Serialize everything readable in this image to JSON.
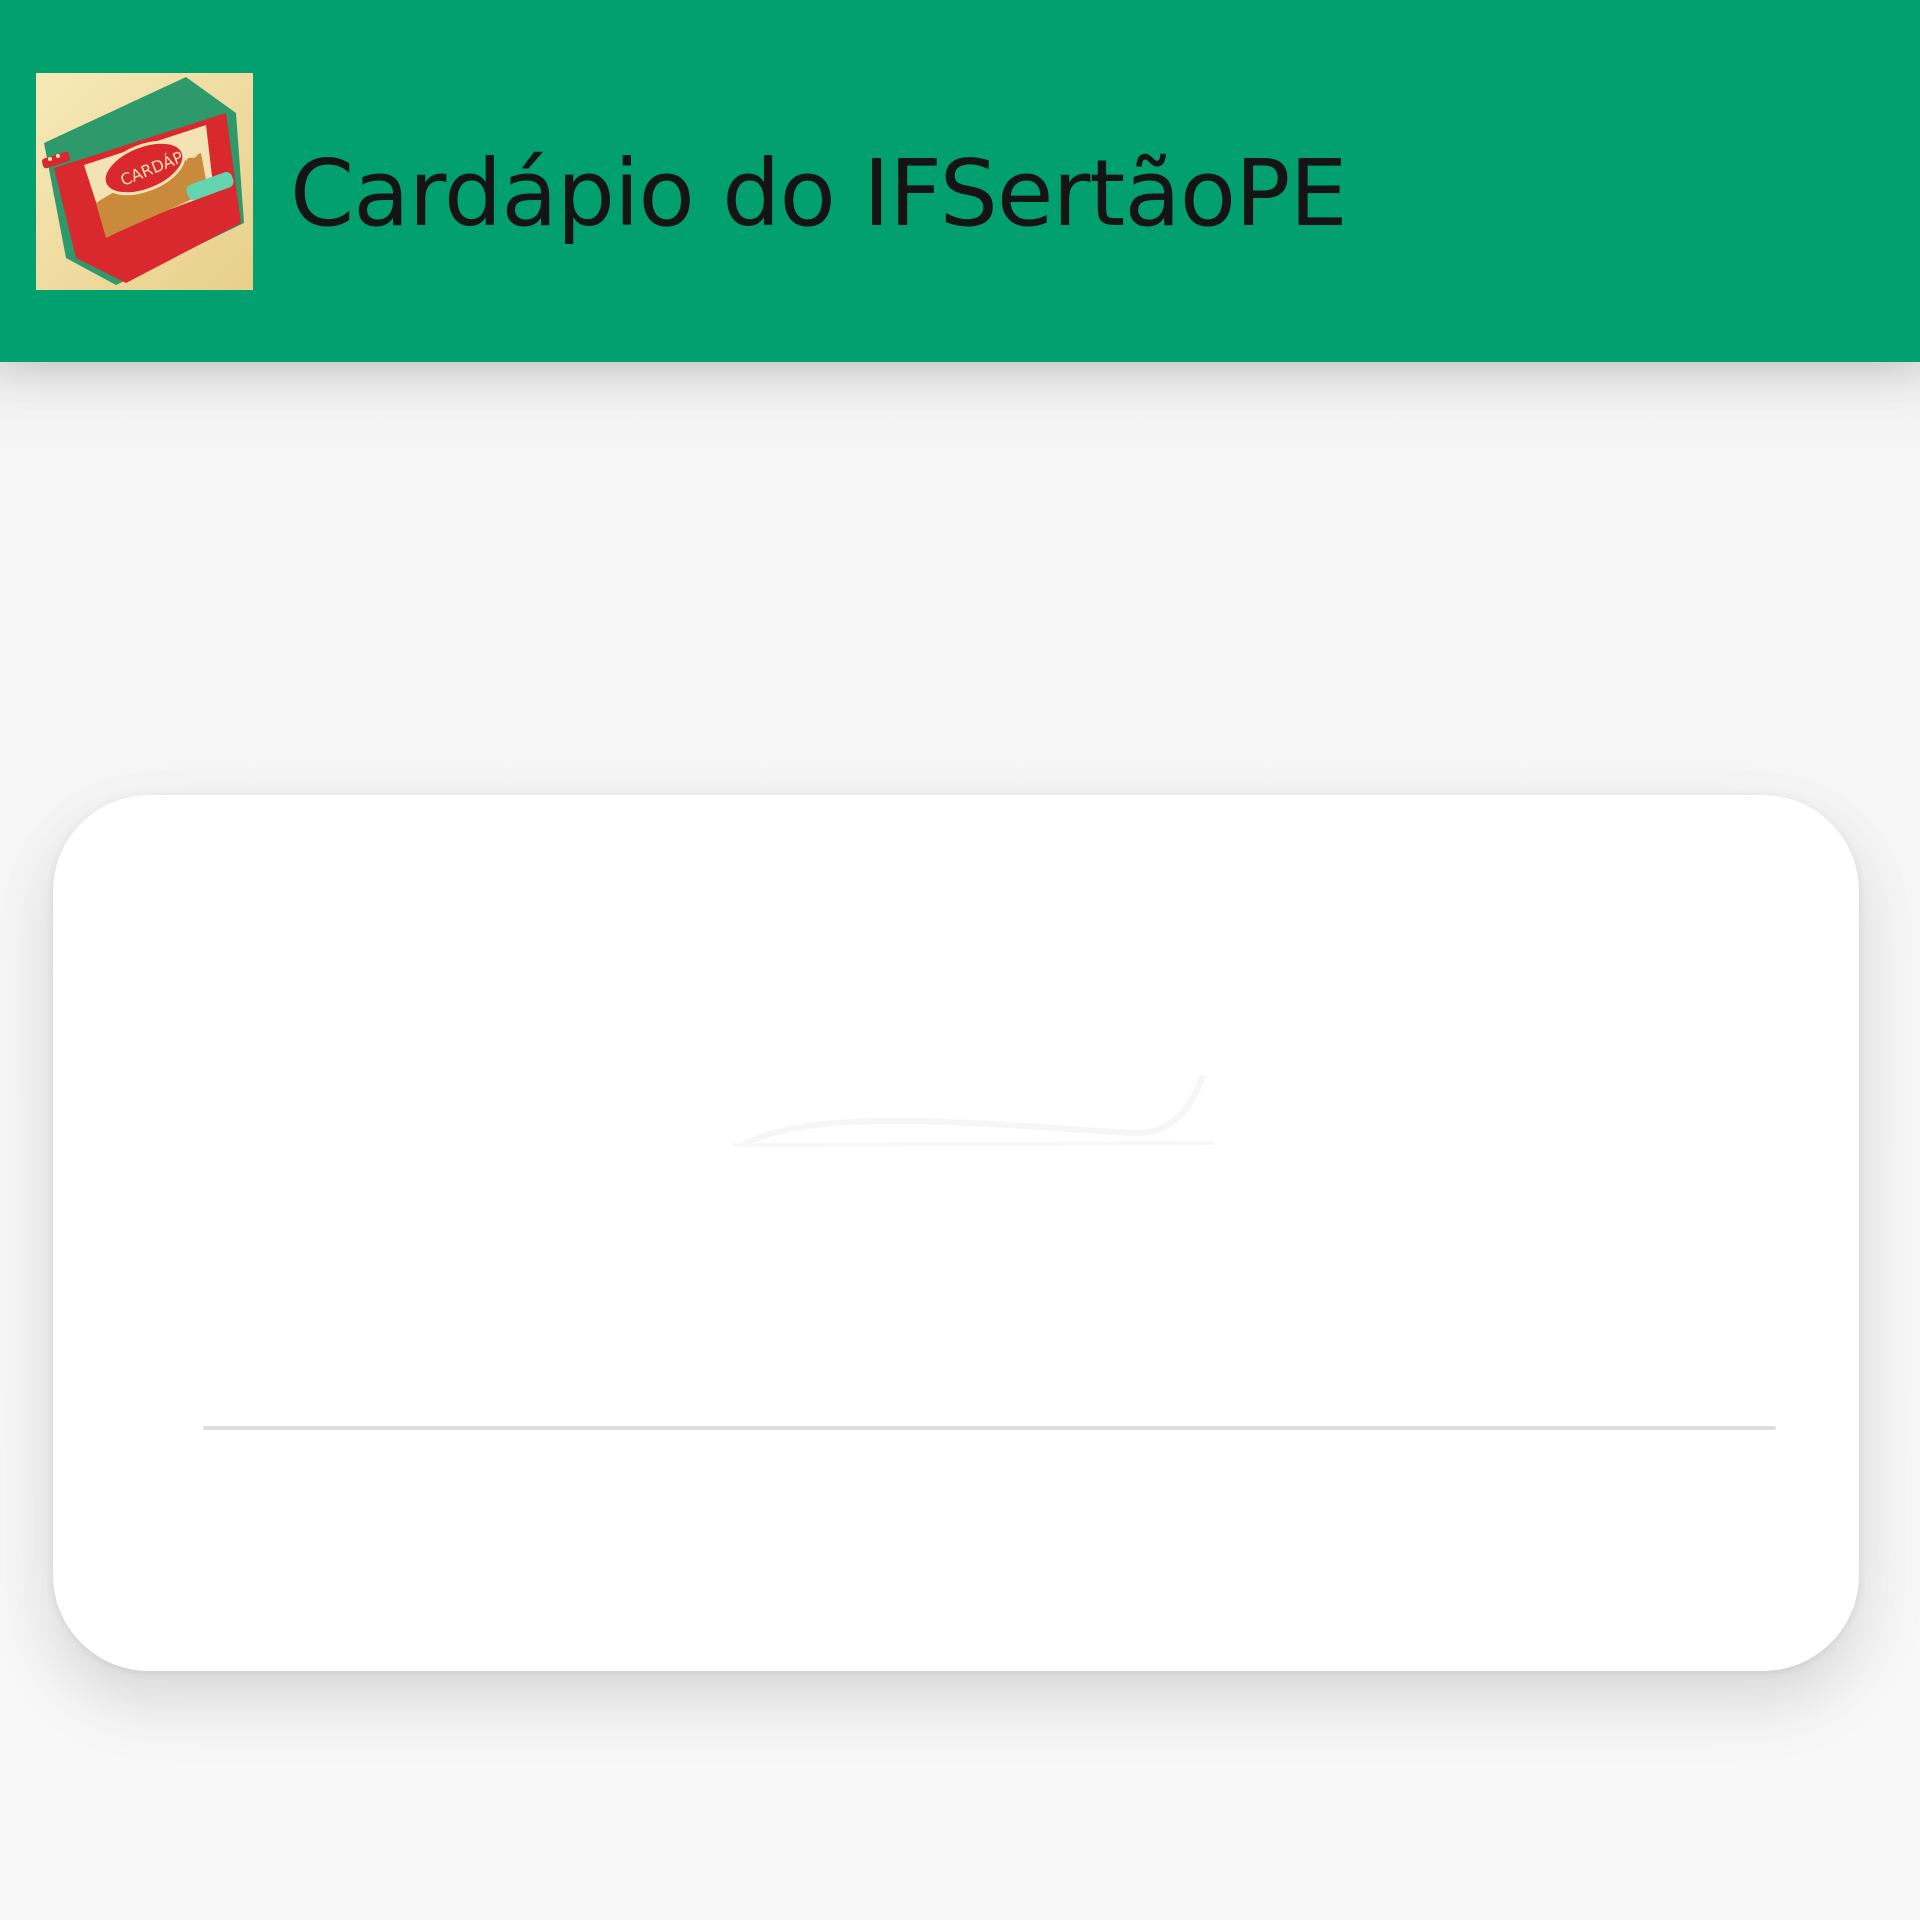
{
  "app_bar": {
    "title": "Cardápio do IFSertãoPE",
    "background_color": "#02a06e",
    "icon": "menu-book-app-icon",
    "icon_badge_text": "CARDÁPIO"
  },
  "card": {
    "image": "faint-menu-image-placeholder",
    "footer_text": ""
  }
}
